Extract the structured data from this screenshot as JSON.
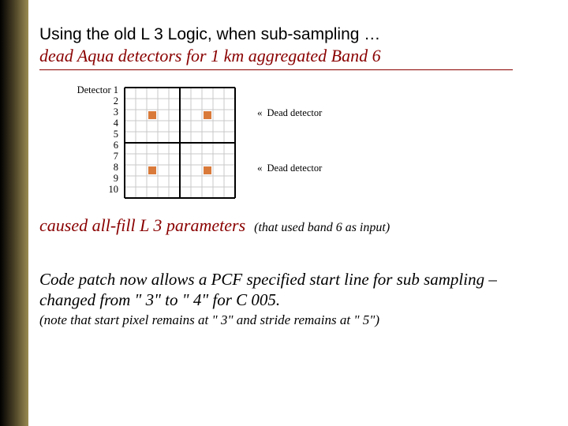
{
  "title": {
    "line1": "Using the old L 3 Logic, when sub-sampling …",
    "line2": "dead Aqua detectors for 1 km aggregated Band 6"
  },
  "detectors": {
    "label_prefix": "Detector",
    "rows": [
      "1",
      "2",
      "3",
      "4",
      "5",
      "6",
      "7",
      "8",
      "9",
      "10"
    ]
  },
  "grid": {
    "cols": 10,
    "rows": 10,
    "cell": 14,
    "agg_cols": 2,
    "agg_rows": 2,
    "dead_cells": [
      {
        "col": 2,
        "row": 2
      },
      {
        "col": 7,
        "row": 2
      },
      {
        "col": 2,
        "row": 7
      },
      {
        "col": 7,
        "row": 7
      }
    ],
    "dead_color": "#d97a3a",
    "line_color": "#c8c8c8",
    "bold_color": "#000000"
  },
  "dead_annotations": {
    "symbol": "«",
    "text": "Dead detector"
  },
  "caused": {
    "main": "caused all-fill L 3 parameters",
    "aside": "(that used band 6 as input)"
  },
  "patch": "Code patch now allows a PCF specified start line for sub sampling – changed from \" 3\" to \" 4\" for C 005.",
  "note": "(note that start pixel remains at \" 3\" and stride remains at \" 5\")"
}
